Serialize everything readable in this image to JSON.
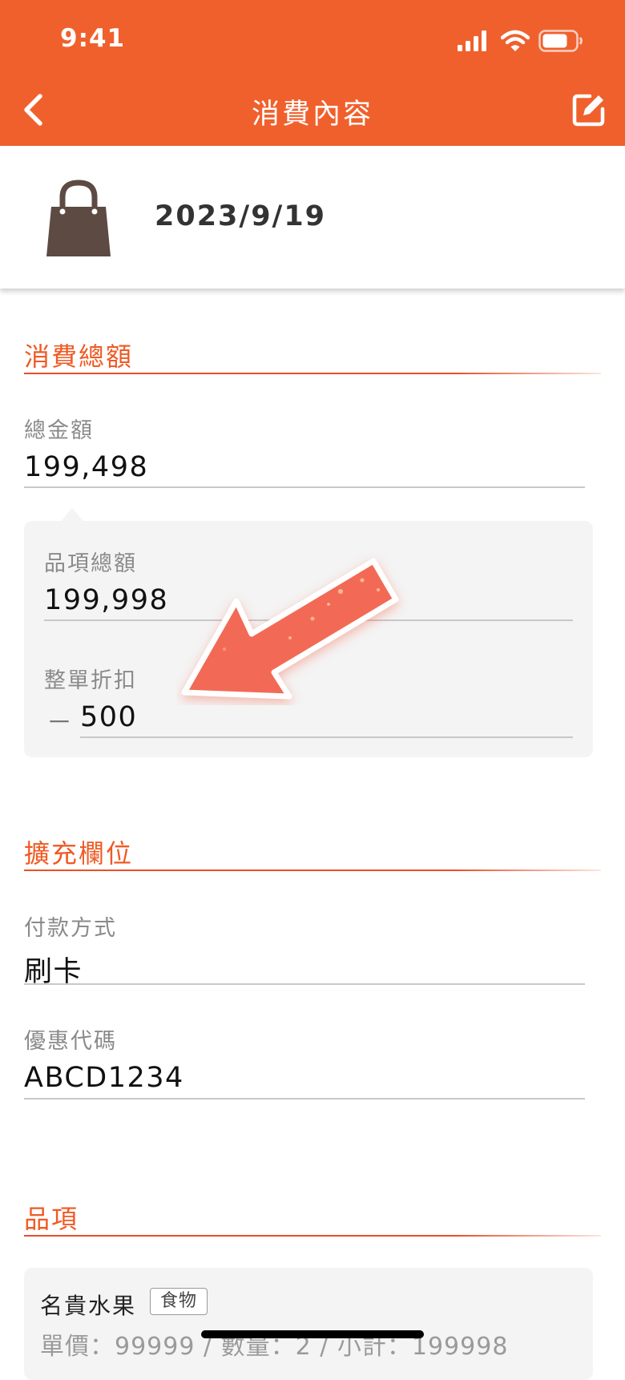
{
  "status_bar": {
    "time": "9:41"
  },
  "nav": {
    "title": "消費內容"
  },
  "record": {
    "date": "2023/9/19"
  },
  "total_section": {
    "title": "消費總額",
    "total_label": "總金額",
    "total_value": "199,498",
    "items_total_label": "品項總額",
    "items_total_value": "199,998",
    "discount_label": "整單折扣",
    "discount_sign": "－",
    "discount_value": "500"
  },
  "extra_section": {
    "title": "擴充欄位",
    "payment_label": "付款方式",
    "payment_value": "刷卡",
    "coupon_label": "優惠代碼",
    "coupon_value": "ABCD1234"
  },
  "items_section": {
    "title": "品項",
    "items": [
      {
        "name": "名貴水果",
        "tag": "食物",
        "detail": "單價：99999 / 數量：2 / 小計：199998"
      }
    ]
  },
  "colors": {
    "accent": "#f0602d",
    "arrow": "#f26a55",
    "bag": "#5d4a43",
    "panel": "#f4f4f4"
  },
  "icons": [
    "signal-icon",
    "wifi-icon",
    "battery-icon",
    "back-chevron-icon",
    "edit-icon",
    "shopping-bag-icon",
    "arrow-annotation-icon"
  ]
}
